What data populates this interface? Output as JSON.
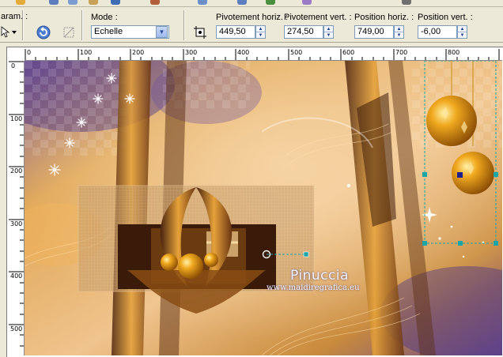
{
  "toolbar": {
    "param_label": "aram. :",
    "mode_label": "Mode :",
    "mode_value": "Echelle",
    "pivot_h_label": "Pivotement horiz. :",
    "pivot_h_value": "449,50",
    "pivot_v_label": "Pivotement vert. :",
    "pivot_v_value": "274,50",
    "pos_h_label": "Position horiz. :",
    "pos_h_value": "749,00",
    "pos_v_label": "Position vert. :",
    "pos_v_value": "-6,00"
  },
  "ruler": {
    "h_labels": [
      "0",
      "100",
      "200",
      "300",
      "400",
      "500",
      "600",
      "700",
      "800"
    ],
    "v_labels": [
      "0",
      "100",
      "200",
      "300",
      "400",
      "500"
    ]
  },
  "watermark": {
    "name": "Pinuccia",
    "url": "www.maidiregrafica.eu"
  },
  "colors": {
    "gold": "#d99a2b",
    "purple": "#5b3d8a",
    "brown": "#5a2e12",
    "selection": "#1aa6a6"
  }
}
